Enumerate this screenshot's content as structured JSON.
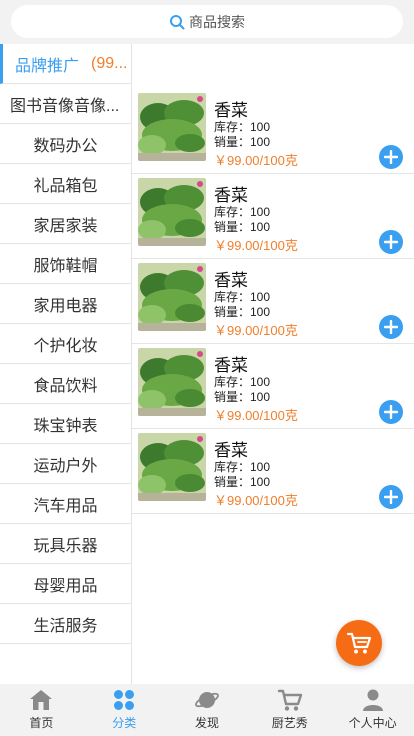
{
  "search": {
    "placeholder": "商品搜索"
  },
  "sidebar": {
    "active": {
      "label": "品牌推广",
      "count": "(99..."
    },
    "items": [
      "图书音像音像...",
      "数码办公",
      "礼品箱包",
      "家居家装",
      "服饰鞋帽",
      "家用电器",
      "个护化妆",
      "食品饮料",
      "珠宝钟表",
      "运动户外",
      "汽车用品",
      "玩具乐器",
      "母婴用品",
      "生活服务"
    ]
  },
  "products": [
    {
      "name": "香菜",
      "stock": "库存：100",
      "sales": "销量：100",
      "price": "￥99.00/100克"
    },
    {
      "name": "香菜",
      "stock": "库存：100",
      "sales": "销量：100",
      "price": "￥99.00/100克"
    },
    {
      "name": "香菜",
      "stock": "库存：100",
      "sales": "销量：100",
      "price": "￥99.00/100克"
    },
    {
      "name": "香菜",
      "stock": "库存：100",
      "sales": "销量：100",
      "price": "￥99.00/100克"
    },
    {
      "name": "香菜",
      "stock": "库存：100",
      "sales": "销量：100",
      "price": "￥99.00/100克"
    }
  ],
  "tabs": [
    {
      "label": "首页",
      "icon": "home-icon"
    },
    {
      "label": "分类",
      "icon": "category-icon"
    },
    {
      "label": "发现",
      "icon": "planet-icon"
    },
    {
      "label": "厨艺秀",
      "icon": "cart-icon"
    },
    {
      "label": "个人中心",
      "icon": "user-icon"
    }
  ],
  "colors": {
    "accent": "#3a9ff0",
    "price": "#f07e2a",
    "fab": "#f56c14"
  }
}
